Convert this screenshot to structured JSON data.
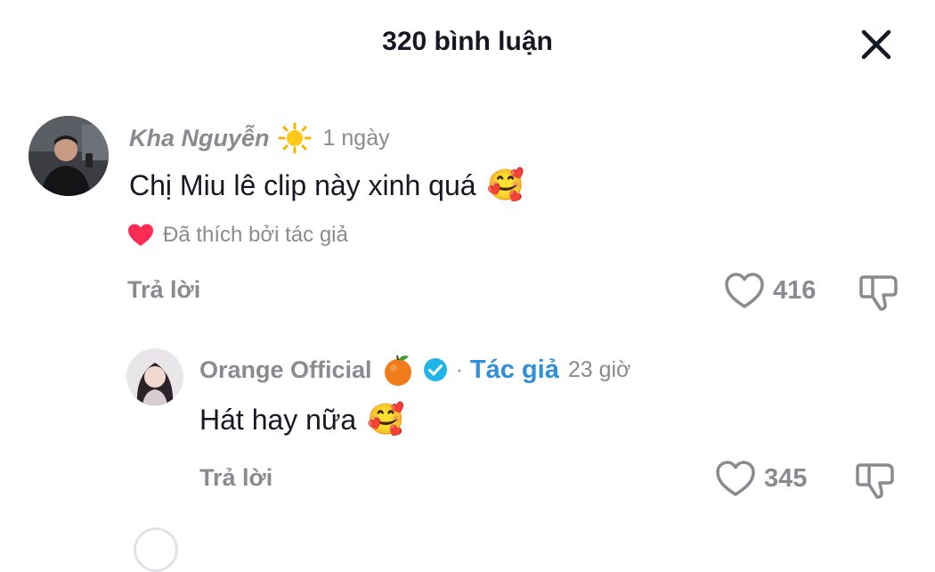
{
  "header": {
    "title": "320 bình luận",
    "close_icon": "close-icon"
  },
  "colors": {
    "muted": "#8a8b91",
    "text": "#161823",
    "verified": "#20b5e8",
    "author": "#2f8fd8",
    "heart": "#fe2c55"
  },
  "comments": [
    {
      "username": "Kha Nguyễn",
      "badge_icon": "sun-icon",
      "time": "1 ngày",
      "text": "Chị Miu lê clip này xinh quá",
      "emoji": "🥰",
      "liked_by_author": "Đã thích bởi tác giả",
      "reply_label": "Trả lời",
      "like_count": "416"
    },
    {
      "username": "Orange Official",
      "badge_icon": "orange-icon",
      "verified_icon": "verified-icon",
      "separator": "·",
      "author_label": "Tác giả",
      "time": "23 giờ",
      "text": "Hát hay nữa",
      "emoji": "🥰",
      "reply_label": "Trả lời",
      "like_count": "345"
    }
  ]
}
